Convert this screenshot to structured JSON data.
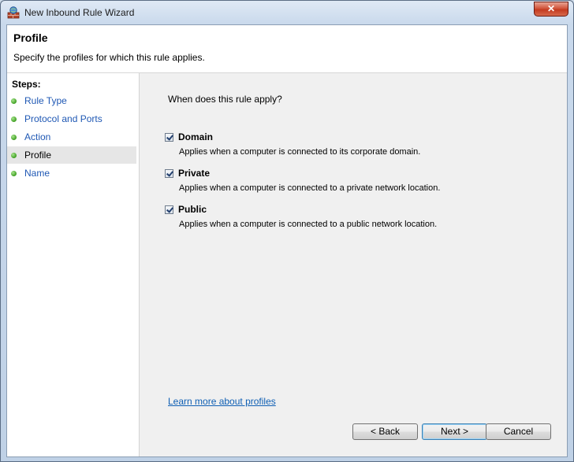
{
  "window": {
    "title": "New Inbound Rule Wizard",
    "close_symbol": "✕"
  },
  "header": {
    "title": "Profile",
    "description": "Specify the profiles for which this rule applies."
  },
  "sidebar": {
    "heading": "Steps:",
    "steps": [
      {
        "label": "Rule Type",
        "current": false
      },
      {
        "label": "Protocol and Ports",
        "current": false
      },
      {
        "label": "Action",
        "current": false
      },
      {
        "label": "Profile",
        "current": true
      },
      {
        "label": "Name",
        "current": false
      }
    ]
  },
  "content": {
    "question": "When does this rule apply?",
    "options": [
      {
        "label": "Domain",
        "description": "Applies when a computer is connected to its corporate domain.",
        "checked": true
      },
      {
        "label": "Private",
        "description": "Applies when a computer is connected to a private network location.",
        "checked": true
      },
      {
        "label": "Public",
        "description": "Applies when a computer is connected to a public network location.",
        "checked": true
      }
    ],
    "learn_more": "Learn more about profiles"
  },
  "buttons": {
    "back": "< Back",
    "next": "Next >",
    "cancel": "Cancel"
  },
  "colors": {
    "link": "#0f5fb4",
    "step_dot": "#3f9f22",
    "close": "#c43b20"
  }
}
